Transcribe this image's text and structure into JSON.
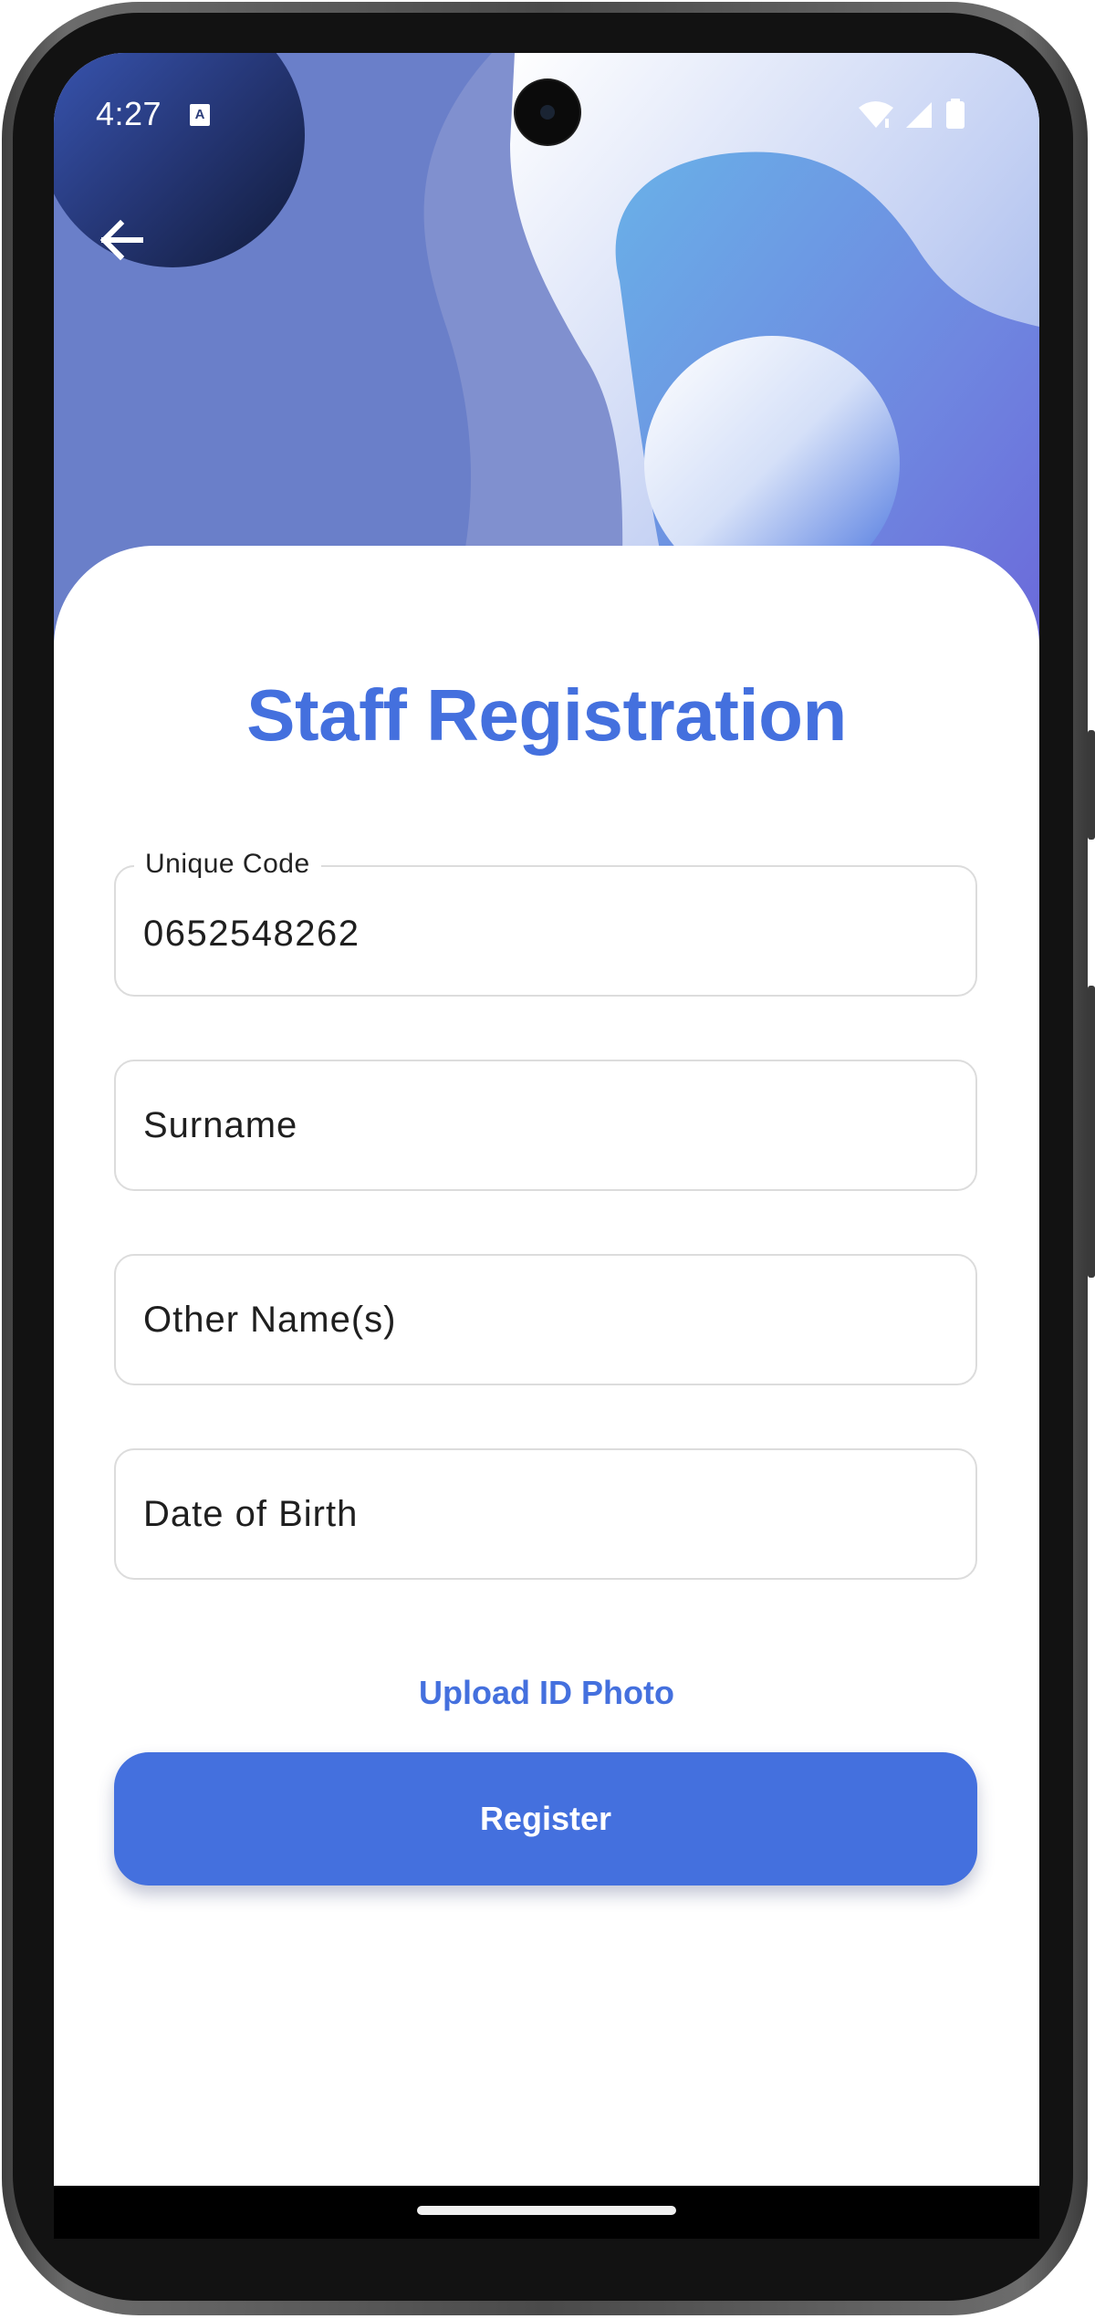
{
  "status_bar": {
    "time": "4:27",
    "notification_icon": "text-recognition-icon",
    "indicator_icons": [
      "wifi-icon",
      "signal-icon",
      "battery-icon"
    ]
  },
  "header": {
    "back_icon": "arrow-left-icon"
  },
  "form": {
    "title": "Staff Registration",
    "unique_code": {
      "label": "Unique Code",
      "value": "0652548262"
    },
    "surname": {
      "placeholder": "Surname"
    },
    "other_names": {
      "placeholder": "Other Name(s)"
    },
    "date_of_birth": {
      "placeholder": "Date of Birth"
    },
    "upload_label": "Upload ID Photo",
    "submit_label": "Register"
  },
  "colors": {
    "accent": "#4470de",
    "hero_base": "#6a7fc9",
    "field_border": "#dcdcdc"
  }
}
